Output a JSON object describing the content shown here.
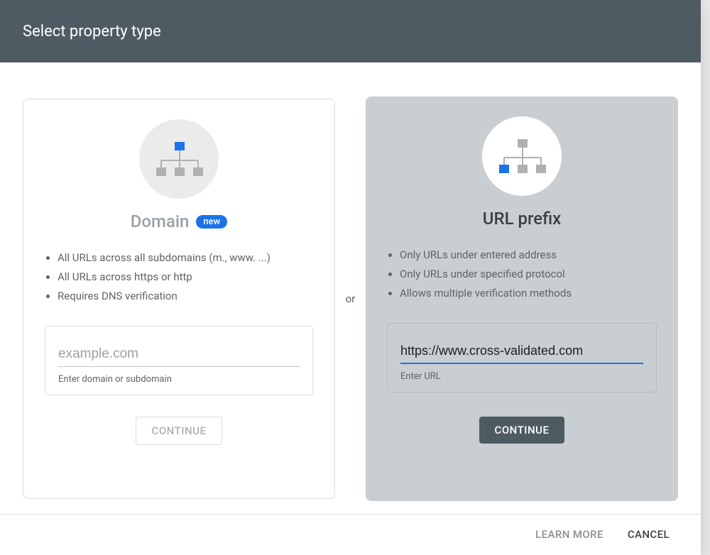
{
  "dialog": {
    "title": "Select property type",
    "divider_label": "or"
  },
  "domain_card": {
    "title": "Domain",
    "badge": "new",
    "bullets": [
      "All URLs across all subdomains (m., www. ...)",
      "All URLs across https or http",
      "Requires DNS verification"
    ],
    "input_value": "",
    "input_placeholder": "example.com",
    "input_helper": "Enter domain or subdomain",
    "continue_label": "CONTINUE",
    "icon": "sitemap-icon"
  },
  "url_card": {
    "title": "URL prefix",
    "bullets": [
      "Only URLs under entered address",
      "Only URLs under specified protocol",
      "Allows multiple verification methods"
    ],
    "input_value": "https://www.cross-validated.com",
    "input_placeholder": "",
    "input_helper": "Enter URL",
    "continue_label": "CONTINUE",
    "icon": "sitemap-icon"
  },
  "footer": {
    "learn_more": "LEARN MORE",
    "cancel": "CANCEL"
  },
  "colors": {
    "header_bg": "#4f5b62",
    "accent": "#1a73e8",
    "right_card_bg": "#C8CED2"
  }
}
